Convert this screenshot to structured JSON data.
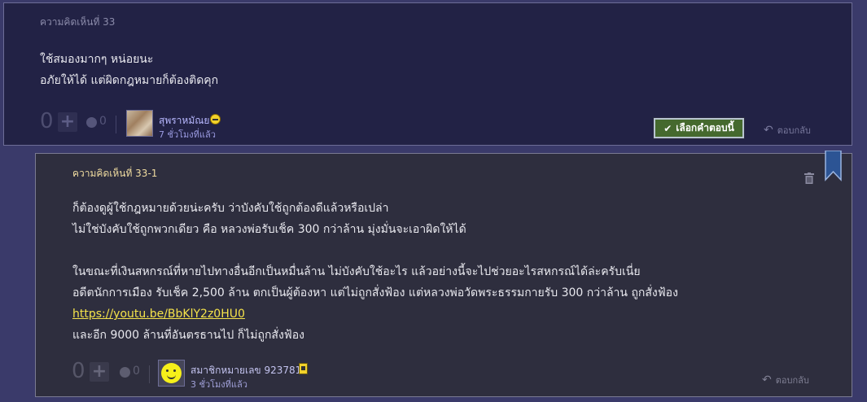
{
  "comment_33": {
    "title": "ความคิดเห็นที่ 33",
    "lines": [
      "ใช้สมองมากๆ หน่อยนะ",
      "อภัยให้ได้ แต่ผิดกฎหมายก็ต้องติดคุก"
    ],
    "votes": "0",
    "emo_count": "0",
    "user_name": "สุพราหมัณย",
    "user_time": "7 ชั่วโมงที่แล้ว",
    "choose_label": "เลือกคำตอบนี้",
    "reply_label": "ตอบกลับ"
  },
  "comment_33_1": {
    "title": "ความคิดเห็นที่ 33-1",
    "lines": [
      "ก็ต้องดูผู้ใช้กฎหมายด้วยน่ะครับ ว่าบังคับใช้ถูกต้องดีแล้วหรือเปล่า",
      "ไม่ใช่บังคับใช้ถูกพวกเดียว คือ หลวงพ่อรับเช็ค 300 กว่าล้าน มุ่งมั่นจะเอาผิดให้ได้",
      "",
      "ในขณะที่เงินสหกรณ์ที่หายไปทางอื่นอีกเป็นหมื่นล้าน ไม่บังคับใช้อะไร แล้วอย่างนี้จะไปช่วยอะไรสหกรณ์ได้ล่ะครับเนี่ย",
      "อดีตนักการเมือง รับเช็ค 2,500 ล้าน ตกเป็นผู้ต้องหา แต่ไม่ถูกสั่งฟ้อง แต่หลวงพ่อวัดพระธรรมกายรับ 300 กว่าล้าน ถูกสั่งฟ้อง"
    ],
    "link": "https://youtu.be/BbKlY2z0HU0",
    "last_line": "และอีก 9000 ล้านที่อันตรธานไป ก็ไม่ถูกสั่งฟ้อง",
    "votes": "0",
    "emo_count": "0",
    "user_name": "สมาชิกหมายเลข 923781",
    "user_time": "3 ชั่วโมงที่แล้ว",
    "reply_label": "ตอบกลับ"
  },
  "icons": [
    "plus-icon",
    "emoticon-icon",
    "avatar-photo",
    "smiley-avatar",
    "laugh-badge-icon",
    "member-card-icon",
    "check-icon",
    "reply-arrow-icon",
    "trash-icon",
    "bookmark-icon"
  ]
}
